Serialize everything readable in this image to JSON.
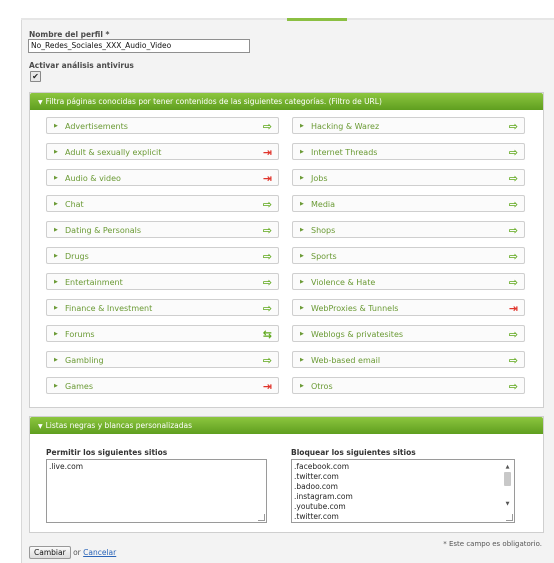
{
  "profile": {
    "name_label": "Nombre del perfil *",
    "name_value": "No_Redes_Sociales_XXX_Audio_Video",
    "antivirus_label": "Activar análisis antivirus",
    "antivirus_checked": true
  },
  "url_filter": {
    "header": "Filtra páginas conocidas por tener contenidos de las siguientes categorías. (Filtro de URL)",
    "left": [
      {
        "label": "Advertisements",
        "state": "allow"
      },
      {
        "label": "Adult & sexually explicit",
        "state": "block"
      },
      {
        "label": "Audio & video",
        "state": "block"
      },
      {
        "label": "Chat",
        "state": "allow"
      },
      {
        "label": "Dating & Personals",
        "state": "allow"
      },
      {
        "label": "Drugs",
        "state": "allow"
      },
      {
        "label": "Entertainment",
        "state": "allow"
      },
      {
        "label": "Finance & Investment",
        "state": "allow"
      },
      {
        "label": "Forums",
        "state": "mixed"
      },
      {
        "label": "Gambling",
        "state": "allow"
      },
      {
        "label": "Games",
        "state": "block"
      }
    ],
    "right": [
      {
        "label": "Hacking & Warez",
        "state": "allow"
      },
      {
        "label": "Internet Threads",
        "state": "allow"
      },
      {
        "label": "Jobs",
        "state": "allow"
      },
      {
        "label": "Media",
        "state": "allow"
      },
      {
        "label": "Shops",
        "state": "allow"
      },
      {
        "label": "Sports",
        "state": "allow"
      },
      {
        "label": "Violence & Hate",
        "state": "allow"
      },
      {
        "label": "WebProxies & Tunnels",
        "state": "block"
      },
      {
        "label": "Weblogs & privatesites",
        "state": "allow"
      },
      {
        "label": "Web-based email",
        "state": "allow"
      },
      {
        "label": "Otros",
        "state": "allow"
      }
    ]
  },
  "lists": {
    "header": "Listas negras y blancas personalizadas",
    "allow_title": "Permitir los siguientes sitios",
    "allow_value": ".live.com",
    "block_title": "Bloquear los siguientes sitios",
    "block_value": ".facebook.com\n.twitter.com\n.badoo.com\n.instagram.com\n.youtube.com\n.twitter.com"
  },
  "required_note": "* Este campo es obligatorio.",
  "footer": {
    "save_label": "Cambiar",
    "or_text": "or",
    "cancel_label": "Cancelar"
  },
  "icons": {
    "allow": "green-arrow-icon",
    "block": "red-block-arrow-icon",
    "mixed": "mixed-arrow-icon"
  },
  "colors": {
    "accent_green": "#6a9a34",
    "header_green": "#7ab52f",
    "block_red": "#e0342b"
  }
}
